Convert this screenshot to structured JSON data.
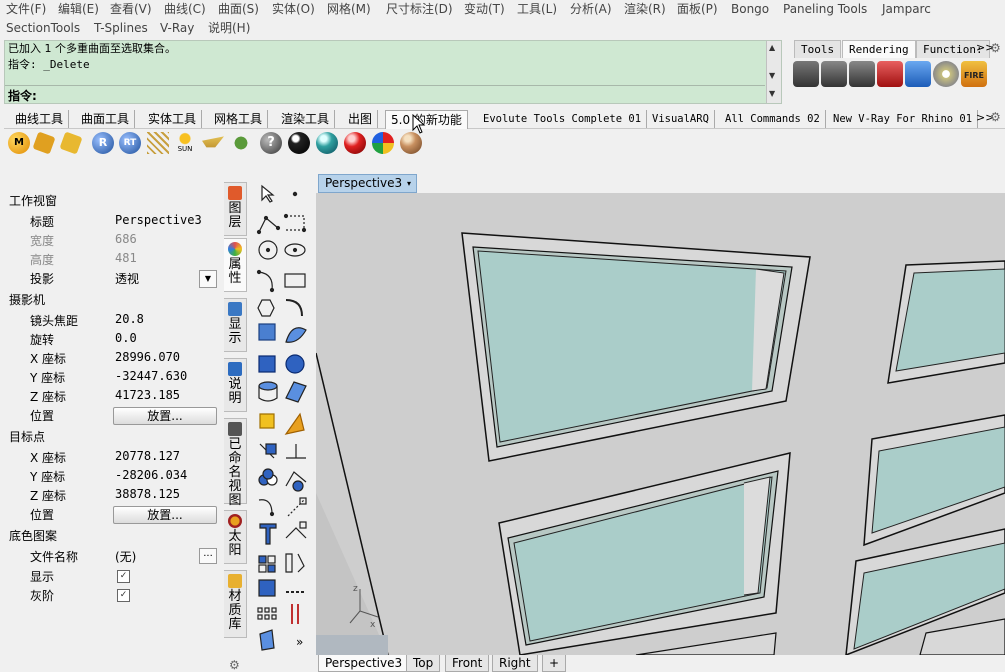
{
  "menu": {
    "row1": [
      "文件(F)",
      "编辑(E)",
      "查看(V)",
      "曲线(C)",
      "曲面(S)",
      "实体(O)",
      "网格(M)",
      "尺寸标注(D)",
      "变动(T)",
      "工具(L)",
      "分析(A)",
      "渲染(R)",
      "面板(P)",
      "Bongo",
      "Paneling Tools",
      "Jamparc"
    ],
    "row2": [
      "SectionTools",
      "T-Splines",
      "V-Ray",
      "说明(H)"
    ]
  },
  "command": {
    "history": [
      "已加入 1 个多重曲面至选取集合。",
      "指令: _Delete"
    ],
    "prompt": "指令:"
  },
  "render_tabs": [
    "Tools",
    "Rendering",
    "Function:",
    ">>"
  ],
  "render_icons": [
    "render-teapot-icon",
    "render-rt-icon",
    "render-v-icon",
    "render-red-icon",
    "render-blue-icon",
    "render-disc-icon",
    "fire-icon"
  ],
  "fire_label": "FIRE",
  "tabs": [
    "曲线工具",
    "曲面工具",
    "实体工具",
    "网格工具",
    "渲染工具",
    "出图",
    "5.0 的新功能",
    "Evolute Tools Complete 01",
    "VisualARQ",
    "All Commands 02",
    "New V-Ray For Rhino 01",
    ">>"
  ],
  "toolbar_icons": [
    {
      "name": "m-icon",
      "label": "M"
    },
    {
      "name": "material-icon",
      "label": ""
    },
    {
      "name": "tag-icon",
      "label": ""
    },
    {
      "name": "r-icon",
      "label": "R"
    },
    {
      "name": "rt-icon",
      "label": "RT"
    },
    {
      "name": "light-icon",
      "label": ""
    },
    {
      "name": "sun-icon",
      "label": "SUN"
    },
    {
      "name": "lamp-icon",
      "label": ""
    },
    {
      "name": "plant-icon",
      "label": ""
    },
    {
      "name": "help-icon",
      "label": "?"
    },
    {
      "name": "sphere-black-icon",
      "label": ""
    },
    {
      "name": "sphere-teal-icon",
      "label": ""
    },
    {
      "name": "sphere-red-icon",
      "label": ""
    },
    {
      "name": "spheres-multi-icon",
      "label": ""
    },
    {
      "name": "sphere-wood-icon",
      "label": ""
    }
  ],
  "properties": {
    "section_viewport": "工作视窗",
    "title_label": "标题",
    "title_value": "Perspective3",
    "width_label": "宽度",
    "width_value": "686",
    "height_label": "高度",
    "height_value": "481",
    "projection_label": "投影",
    "projection_value": "透视",
    "section_camera": "摄影机",
    "lens_label": "镜头焦距",
    "lens_value": "20.8",
    "rotation_label": "旋转",
    "rotation_value": "0.0",
    "cx_label": "X 座标",
    "cx_value": "28996.070",
    "cy_label": "Y 座标",
    "cy_value": "-32447.630",
    "cz_label": "Z 座标",
    "cz_value": "41723.185",
    "cam_pos_label": "位置",
    "place_button": "放置...",
    "section_target": "目标点",
    "tx_label": "X 座标",
    "tx_value": "20778.127",
    "ty_label": "Y 座标",
    "ty_value": "-28206.034",
    "tz_label": "Z 座标",
    "tz_value": "38878.125",
    "target_pos_label": "位置",
    "section_background": "底色图案",
    "filename_label": "文件名称",
    "filename_value": "(无)",
    "browse_button": "...",
    "show_label": "显示",
    "show_checked": true,
    "gray_label": "灰阶",
    "gray_checked": true,
    "check_mark": "✓"
  },
  "vertical_tabs": [
    {
      "name": "layers",
      "label": "图层",
      "color": "#e05a2b"
    },
    {
      "name": "properties",
      "label": "属性",
      "color": "#d86fbb"
    },
    {
      "name": "display",
      "label": "显示",
      "color": "#3a78c4"
    },
    {
      "name": "help",
      "label": "说明",
      "color": "#2d6cc0"
    },
    {
      "name": "named-views",
      "label": "已命名视图",
      "color": "#555555"
    },
    {
      "name": "sun",
      "label": "太阳",
      "color": "#e8a020"
    },
    {
      "name": "materials",
      "label": "材质库",
      "color": "#e8b030"
    }
  ],
  "viewport": {
    "title": "Perspective3",
    "dropdown": "▾"
  },
  "viewport_tabs": [
    "Perspective3",
    "Top",
    "Front",
    "Right",
    "+"
  ],
  "colors": {
    "command_bg": "#cfe8d2",
    "viewport_bg": "#cecece",
    "glass": "#aacdc9",
    "active_title": "#b7d2ea"
  }
}
